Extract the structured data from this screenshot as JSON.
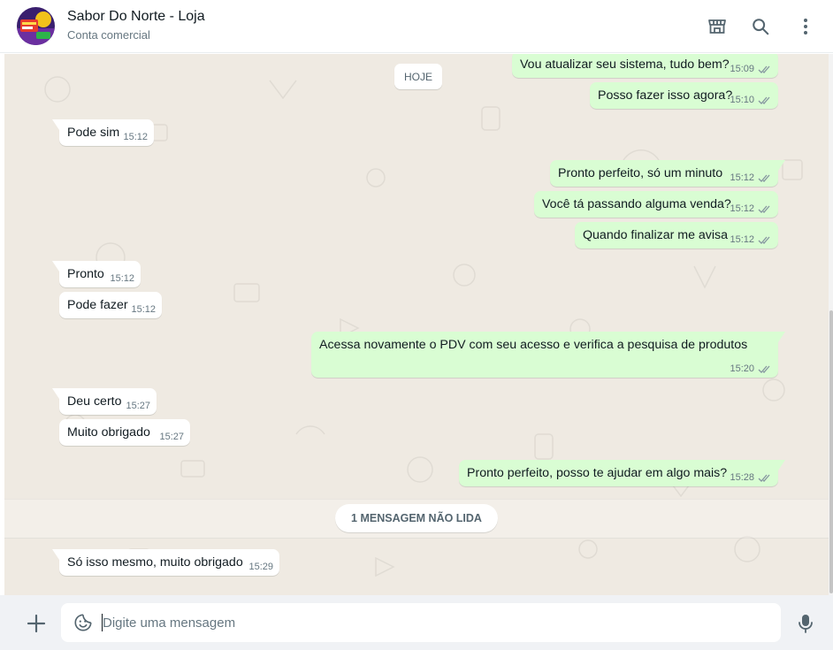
{
  "header": {
    "contact_name": "Sabor Do Norte - Loja",
    "contact_subtitle": "Conta comercial",
    "icons": [
      "store-icon",
      "search-icon",
      "menu-icon"
    ]
  },
  "chat": {
    "date_chip": "HOJE",
    "unread_label": "1 MENSAGEM NÃO LIDA",
    "messages": [
      {
        "dir": "out",
        "text": "Vou atualizar seu sistema, tudo bem?",
        "time": "15:09",
        "status": "read"
      },
      {
        "dir": "out",
        "text": "Posso fazer isso agora?",
        "time": "15:10",
        "status": "read"
      },
      {
        "dir": "in",
        "text": "Pode sim",
        "time": "15:12"
      },
      {
        "dir": "out",
        "text": "Pronto perfeito, só um minuto",
        "time": "15:12",
        "status": "read"
      },
      {
        "dir": "out",
        "text": "Você tá passando alguma venda?",
        "time": "15:12",
        "status": "read"
      },
      {
        "dir": "out",
        "text": "Quando finalizar me avisa",
        "time": "15:12",
        "status": "read"
      },
      {
        "dir": "in",
        "text": "Pronto",
        "time": "15:12"
      },
      {
        "dir": "in",
        "text": "Pode fazer",
        "time": "15:12"
      },
      {
        "dir": "out",
        "text": "Acessa novamente o PDV com seu acesso e verifica a pesquisa de produtos",
        "time": "15:20",
        "status": "read"
      },
      {
        "dir": "in",
        "text": "Deu certo",
        "time": "15:27"
      },
      {
        "dir": "in",
        "text": "Muito obrigado",
        "time": "15:27"
      },
      {
        "dir": "out",
        "text": "Pronto perfeito, posso te ajudar em algo mais?",
        "time": "15:28",
        "status": "read"
      },
      {
        "dir": "in",
        "text": "Só isso mesmo, muito obrigado",
        "time": "15:29"
      }
    ]
  },
  "footer": {
    "placeholder": "Digite uma mensagem",
    "value": ""
  },
  "colors": {
    "outgoing_bubble": "#d9fdd3",
    "incoming_bubble": "#ffffff",
    "chat_background": "#efeae2",
    "read_check": "#8696a0"
  }
}
